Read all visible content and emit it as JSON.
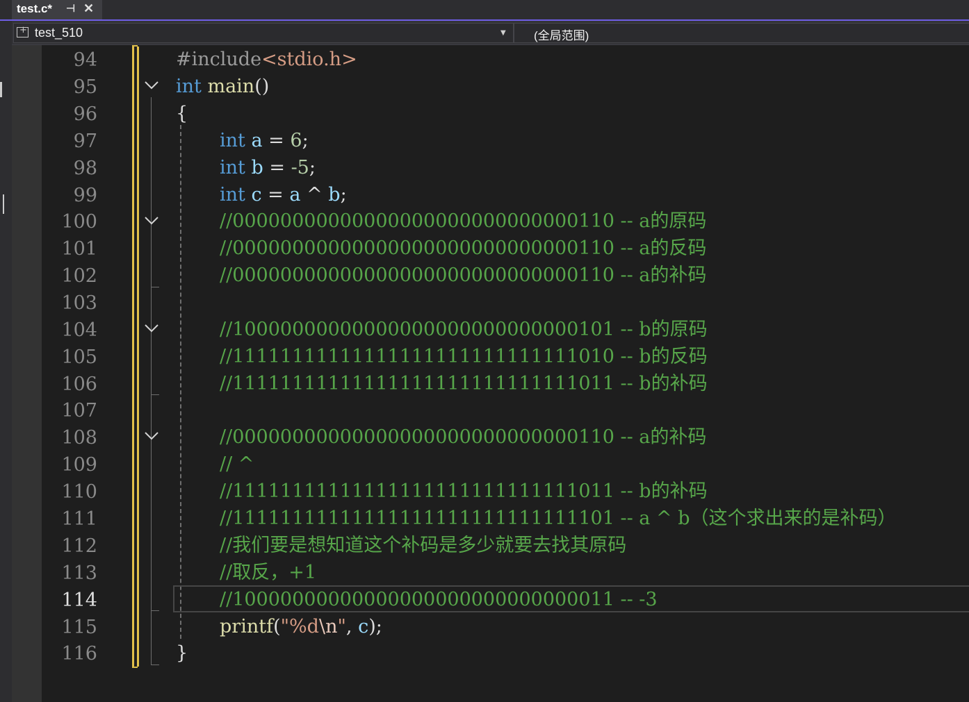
{
  "tab": {
    "title": "test.c*",
    "pin_icon": "pin-icon",
    "close_icon": "close-icon"
  },
  "navbar": {
    "project": "test_510",
    "scope": "(全局范围)"
  },
  "colors": {
    "keyword": "#569cd6",
    "comment": "#57a64a",
    "number": "#b5cea8",
    "string": "#d69d85",
    "variable": "#9cdcfe",
    "function": "#dcdcaa",
    "change_bar": "#e2c04a",
    "accent": "#6f5ee6"
  },
  "editor": {
    "current_line": "114",
    "line_numbers": [
      "94",
      "95",
      "96",
      "97",
      "98",
      "99",
      "100",
      "101",
      "102",
      "103",
      "104",
      "105",
      "106",
      "107",
      "108",
      "109",
      "110",
      "111",
      "112",
      "113",
      "114",
      "115",
      "116"
    ],
    "code": {
      "l94_pp": "#include",
      "l94_inc": "<stdio.h>",
      "l95_kw": "int",
      "l95_fn": "main",
      "l95_rest": "()",
      "l96": "{",
      "l97_kw": "int",
      "l97_var": "a",
      "l97_op": " = ",
      "l97_num": "6",
      "l97_end": ";",
      "l98_kw": "int",
      "l98_var": "b",
      "l98_op": " = ",
      "l98_num": "-5",
      "l98_end": ";",
      "l99_kw": "int",
      "l99_var1": "c",
      "l99_op": " = ",
      "l99_var2": "a",
      "l99_op2": " ^ ",
      "l99_var3": "b",
      "l99_end": ";",
      "l100": "//00000000000000000000000000000110 -- a的原码",
      "l101": "//00000000000000000000000000000110 -- a的反码",
      "l102": "//00000000000000000000000000000110 -- a的补码",
      "l104": "//10000000000000000000000000000101 -- b的原码",
      "l105": "//11111111111111111111111111111010 -- b的反码",
      "l106": "//11111111111111111111111111111011 -- b的补码",
      "l108": "//00000000000000000000000000000110 -- a的补码",
      "l109": "// ^",
      "l110": "//11111111111111111111111111111011 -- b的补码",
      "l111": "//11111111111111111111111111111101 -- a ^ b（这个求出来的是补码）",
      "l112": "//我们要是想知道这个补码是多少就要去找其原码",
      "l113": "//取反，+1",
      "l114": "//10000000000000000000000000000011 -- -3",
      "l115_fn": "printf",
      "l115_p1": "(",
      "l115_str1": "\"%d",
      "l115_esc": "\\n",
      "l115_str2": "\"",
      "l115_mid": ", ",
      "l115_var": "c",
      "l115_end": ");",
      "l116": "}"
    }
  }
}
